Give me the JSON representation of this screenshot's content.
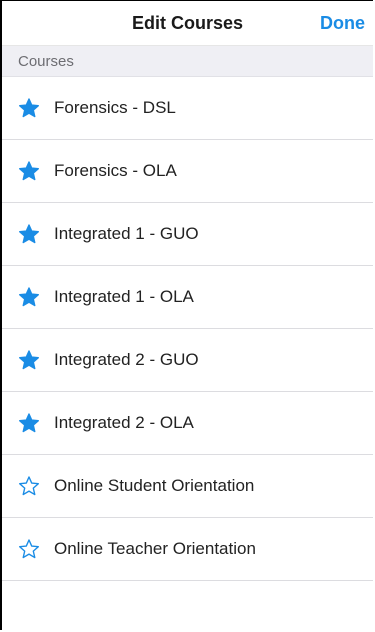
{
  "nav": {
    "title": "Edit Courses",
    "done_label": "Done"
  },
  "section": {
    "header": "Courses"
  },
  "courses": [
    {
      "name": "Forensics - DSL",
      "favorite": true,
      "icon": "star-filled-icon"
    },
    {
      "name": "Forensics - OLA",
      "favorite": true,
      "icon": "star-filled-icon"
    },
    {
      "name": "Integrated 1 - GUO",
      "favorite": true,
      "icon": "star-filled-icon"
    },
    {
      "name": "Integrated 1 - OLA",
      "favorite": true,
      "icon": "star-filled-icon"
    },
    {
      "name": "Integrated 2 - GUO",
      "favorite": true,
      "icon": "star-filled-icon"
    },
    {
      "name": "Integrated 2 - OLA",
      "favorite": true,
      "icon": "star-filled-icon"
    },
    {
      "name": "Online Student Orientation",
      "favorite": false,
      "icon": "star-outline-icon"
    },
    {
      "name": "Online Teacher Orientation",
      "favorite": false,
      "icon": "star-outline-icon"
    }
  ],
  "colors": {
    "accent": "#1a8ce5",
    "section_bg": "#efeff4"
  }
}
